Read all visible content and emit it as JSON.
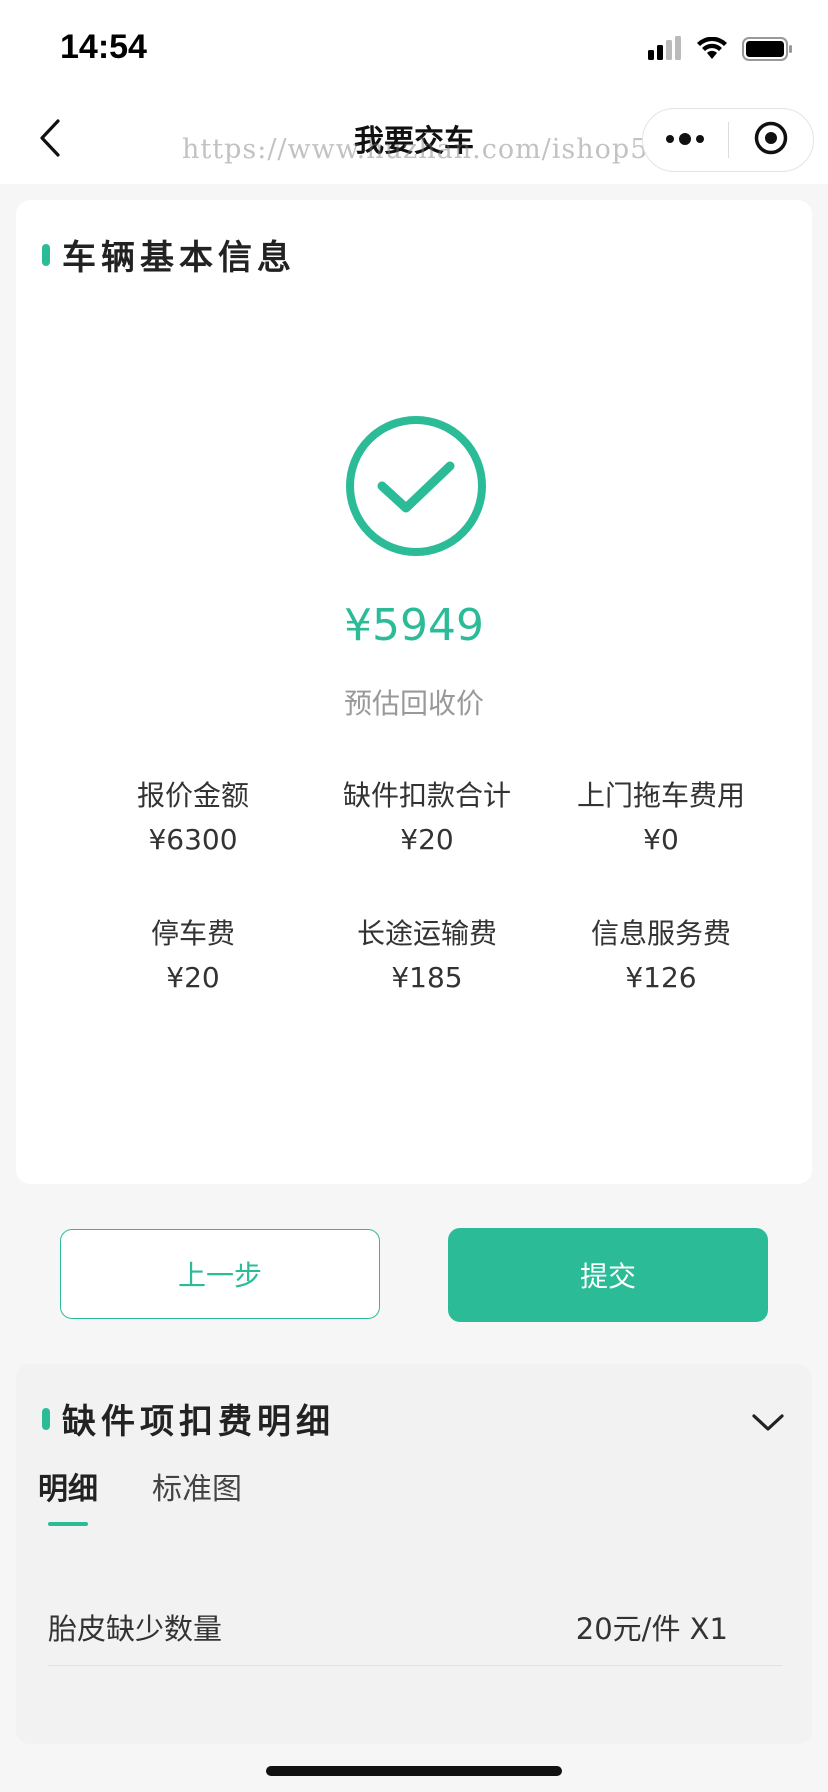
{
  "status_bar": {
    "time": "14:54"
  },
  "nav": {
    "title": "我要交车",
    "watermark": "https://www.huzhan.com/ishop50509"
  },
  "vehicle_info": {
    "section_title": "车辆基本信息",
    "price": "¥5949",
    "price_label": "预估回收价",
    "fees": [
      {
        "label": "报价金额",
        "value": "¥6300"
      },
      {
        "label": "缺件扣款合计",
        "value": "¥20"
      },
      {
        "label": "上门拖车费用",
        "value": "¥0"
      },
      {
        "label": "停车费",
        "value": "¥20"
      },
      {
        "label": "长途运输费",
        "value": "¥185"
      },
      {
        "label": "信息服务费",
        "value": "¥126"
      }
    ]
  },
  "actions": {
    "prev_label": "上一步",
    "submit_label": "提交"
  },
  "defects": {
    "section_title": "缺件项扣费明细",
    "tabs": [
      {
        "label": "明细",
        "active": true
      },
      {
        "label": "标准图",
        "active": false
      }
    ],
    "items": [
      {
        "name": "胎皮缺少数量",
        "price": "20元/件 X1"
      }
    ]
  },
  "colors": {
    "accent": "#2bbc97"
  }
}
